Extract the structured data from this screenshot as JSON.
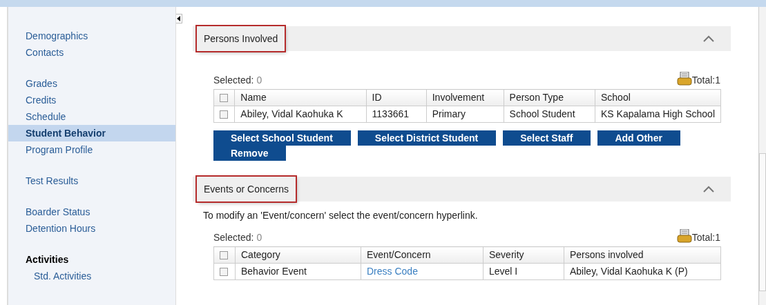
{
  "sidebar": {
    "groups": [
      {
        "items": [
          {
            "label": "Demographics",
            "selected": false
          },
          {
            "label": "Contacts",
            "selected": false
          }
        ]
      },
      {
        "items": [
          {
            "label": "Grades",
            "selected": false
          },
          {
            "label": "Credits",
            "selected": false
          },
          {
            "label": "Schedule",
            "selected": false
          },
          {
            "label": "Student Behavior",
            "selected": true
          },
          {
            "label": "Program Profile",
            "selected": false
          }
        ]
      },
      {
        "items": [
          {
            "label": "Test Results",
            "selected": false
          }
        ]
      },
      {
        "items": [
          {
            "label": "Boarder Status",
            "selected": false
          },
          {
            "label": "Detention Hours",
            "selected": false
          }
        ]
      },
      {
        "heading": "Activities",
        "items": [
          {
            "label": "Std. Activities",
            "selected": false
          }
        ]
      }
    ]
  },
  "sections": [
    {
      "title": "Persons Involved",
      "expanded": true,
      "all_checked": false,
      "selected_label": "Selected:",
      "selected_count": "0",
      "total": "Total:1",
      "columns": [
        "Name",
        "ID",
        "Involvement",
        "Person Type",
        "School"
      ],
      "rows": [
        {
          "checked": false,
          "cells": [
            {
              "kind": "text",
              "text": "Abiley, Vidal Kaohuka K"
            },
            {
              "kind": "text",
              "text": "1133661"
            },
            {
              "kind": "text",
              "text": "Primary"
            },
            {
              "kind": "text",
              "text": "School Student"
            },
            {
              "kind": "text",
              "text": "KS Kapalama High School"
            }
          ]
        }
      ],
      "buttons": [
        "Select School Student",
        "Select District Student",
        "Select Staff",
        "Add Other",
        "Remove"
      ]
    },
    {
      "title": "Events or Concerns",
      "expanded": true,
      "all_checked": false,
      "note": "To modify an 'Event/concern' select the event/concern hyperlink.",
      "selected_label": "Selected:",
      "selected_count": "0",
      "total": "Total:1",
      "columns": [
        "Category",
        "Event/Concern",
        "Severity",
        "Persons involved"
      ],
      "rows": [
        {
          "checked": false,
          "cells": [
            {
              "kind": "text",
              "text": "Behavior Event"
            },
            {
              "kind": "link",
              "text": "Dress Code"
            },
            {
              "kind": "text",
              "text": "Level I"
            },
            {
              "kind": "text",
              "text": "Abiley, Vidal Kaohuka K (P)"
            }
          ]
        }
      ]
    }
  ]
}
